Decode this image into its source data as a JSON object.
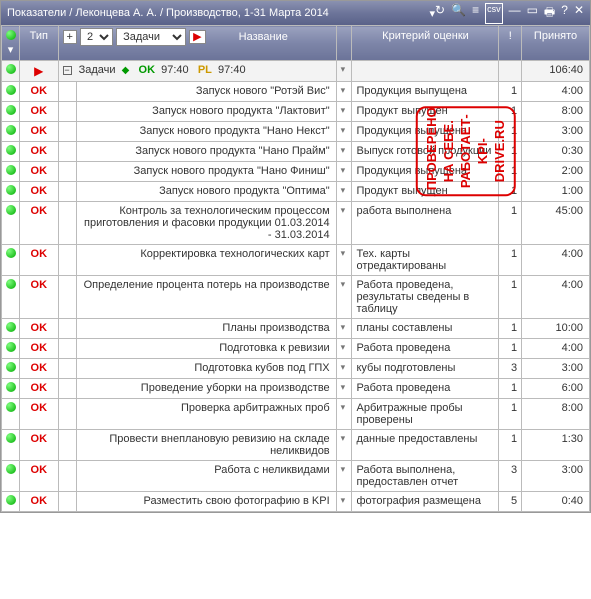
{
  "titlebar": {
    "title": "Показатели / Леконцева А. А. / Производство, 1-31 Марта 2014",
    "icons": [
      "refresh-icon",
      "search-icon",
      "list-icon",
      "csv-icon",
      "minimize-icon",
      "restore-icon",
      "print-icon",
      "help-icon",
      "close-icon"
    ]
  },
  "toolbar": {
    "type_label": "Тип",
    "plus": "+",
    "num": "2",
    "tasks": "Задачи",
    "name_label": "Название",
    "criteria_label": "Критерий оценки",
    "excl_label": "!",
    "accepted_label": "Принято"
  },
  "summary": {
    "tasks_label": "Задачи",
    "ok_label": "OK",
    "ok_time": "97:40",
    "pl_label": "PL",
    "pl_time": "97:40",
    "accepted": "106:40"
  },
  "rows": [
    {
      "ok": "OK",
      "name": "Запуск нового \"Ротэй Вис\"",
      "crit": "Продукция выпущена",
      "excl": "1",
      "acc": "4:00"
    },
    {
      "ok": "OK",
      "name": "Запуск нового продукта \"Лактовит\"",
      "crit": "Продукт выпущен",
      "excl": "1",
      "acc": "8:00"
    },
    {
      "ok": "OK",
      "name": "Запуск нового продукта \"Нано Некст\"",
      "crit": "Продукция выпущена",
      "excl": "1",
      "acc": "3:00"
    },
    {
      "ok": "OK",
      "name": "Запуск нового продукта \"Нано Прайм\"",
      "crit": "Выпуск готовой продукции",
      "excl": "1",
      "acc": "0:30"
    },
    {
      "ok": "OK",
      "name": "Запуск нового продукта \"Нано Финиш\"",
      "crit": "Продукция выпущена",
      "excl": "1",
      "acc": "2:00"
    },
    {
      "ok": "OK",
      "name": "Запуск нового продукта \"Оптима\"",
      "crit": "Продукт выпущен",
      "excl": "1",
      "acc": "1:00"
    },
    {
      "ok": "OK",
      "name": "Контроль за технологическим процессом приготовления и фасовки продукции 01.03.2014 - 31.03.2014",
      "crit": "работа выполнена",
      "excl": "1",
      "acc": "45:00"
    },
    {
      "ok": "OK",
      "name": "Корректировка технологических карт",
      "crit": "Тех. карты отредактированы",
      "excl": "1",
      "acc": "4:00"
    },
    {
      "ok": "OK",
      "name": "Определение процента потерь на производстве",
      "crit": "Работа проведена, результаты сведены в таблицу",
      "excl": "1",
      "acc": "4:00"
    },
    {
      "ok": "OK",
      "name": "Планы производства",
      "crit": "планы составлены",
      "excl": "1",
      "acc": "10:00"
    },
    {
      "ok": "OK",
      "name": "Подготовка к ревизии",
      "crit": "Работа проведена",
      "excl": "1",
      "acc": "4:00"
    },
    {
      "ok": "OK",
      "name": "Подготовка кубов под ГПХ",
      "crit": "кубы подготовлены",
      "excl": "3",
      "acc": "3:00"
    },
    {
      "ok": "OK",
      "name": "Проведение уборки на производстве",
      "crit": "Работа проведена",
      "excl": "1",
      "acc": "6:00"
    },
    {
      "ok": "OK",
      "name": "Проверка арбитражных проб",
      "crit": "Арбитражные пробы проверены",
      "excl": "1",
      "acc": "8:00"
    },
    {
      "ok": "OK",
      "name": "Провести внеплановую ревизию на складе неликвидов",
      "crit": "данные предоставлены",
      "excl": "1",
      "acc": "1:30"
    },
    {
      "ok": "OK",
      "name": "Работа с неликвидами",
      "crit": "Работа выполнена, предоставлен отчет",
      "excl": "3",
      "acc": "3:00"
    },
    {
      "ok": "OK",
      "name": "Разместить свою фотографию в KPI",
      "crit": "фотография размещена",
      "excl": "5",
      "acc": "0:40"
    }
  ],
  "stamp": {
    "line1": "ПРОВЕРЕНО НА СЕБЕ.",
    "line2": "РАБОТАЕТ-",
    "line3": "KPI-DRIVE.RU"
  }
}
